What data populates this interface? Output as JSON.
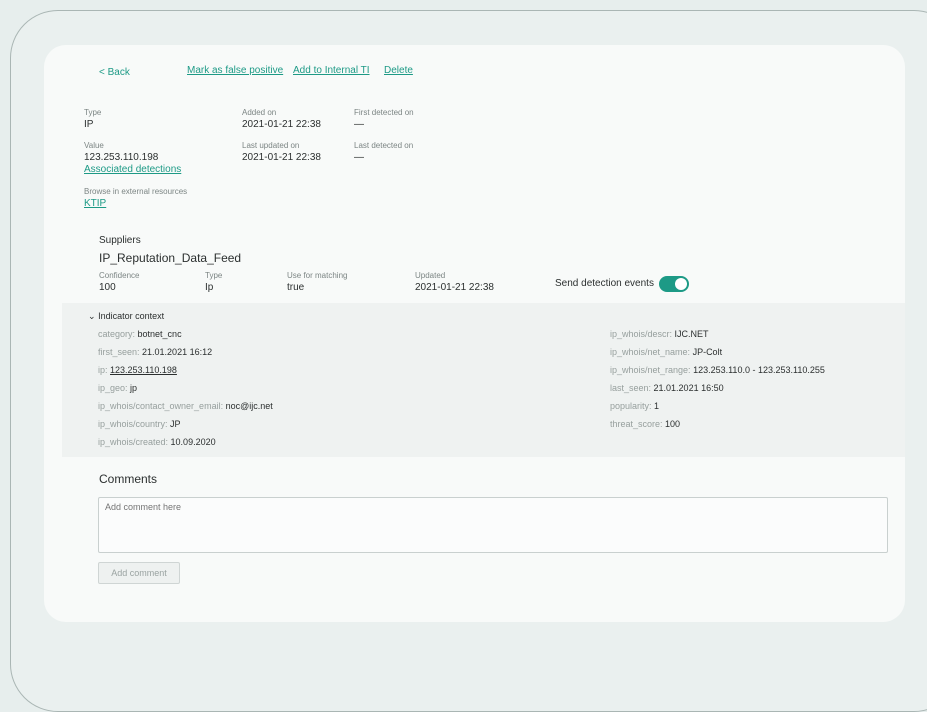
{
  "toolbar": {
    "back": "< Back",
    "mark_false_positive": "Mark as false positive",
    "add_internal_ti": "Add to Internal TI",
    "delete": "Delete"
  },
  "indicator": {
    "type_label": "Type",
    "type_value": "IP",
    "added_label": "Added on",
    "added_value": "2021-01-21 22:38",
    "first_detected_label": "First detected on",
    "first_detected_value": "—",
    "value_label": "Value",
    "value_value": "123.253.110.198",
    "associated_detections": "Associated detections",
    "last_updated_label": "Last updated on",
    "last_updated_value": "2021-01-21 22:38",
    "last_detected_label": "Last detected on",
    "last_detected_value": "—",
    "browse_label": "Browse in external resources",
    "browse_link": "KTIP"
  },
  "suppliers": {
    "title": "Suppliers",
    "name": "IP_Reputation_Data_Feed",
    "confidence_label": "Confidence",
    "confidence_value": "100",
    "type_label": "Type",
    "type_value": "Ip",
    "matching_label": "Use for matching",
    "matching_value": "true",
    "updated_label": "Updated",
    "updated_value": "2021-01-21 22:38",
    "send_events_label": "Send detection events",
    "send_events_on": true
  },
  "context": {
    "title": "Indicator context",
    "left": [
      {
        "key": "category: ",
        "value": "botnet_cnc"
      },
      {
        "key": "first_seen: ",
        "value": "21.01.2021 16:12"
      },
      {
        "key": "ip: ",
        "value": "123.253.110.198"
      },
      {
        "key": "ip_geo: ",
        "value": "jp"
      },
      {
        "key": "ip_whois/contact_owner_email: ",
        "value": "noc@ijc.net"
      },
      {
        "key": "ip_whois/country: ",
        "value": "JP"
      },
      {
        "key": "ip_whois/created: ",
        "value": "10.09.2020"
      }
    ],
    "right": [
      {
        "key": "ip_whois/descr: ",
        "value": "IJC.NET"
      },
      {
        "key": "ip_whois/net_name: ",
        "value": "JP-Colt"
      },
      {
        "key": "ip_whois/net_range: ",
        "value": "123.253.110.0 - 123.253.110.255"
      },
      {
        "key": "last_seen: ",
        "value": "21.01.2021 16:50"
      },
      {
        "key": "popularity: ",
        "value": "1"
      },
      {
        "key": "threat_score: ",
        "value": "100"
      }
    ]
  },
  "comments": {
    "title": "Comments",
    "placeholder": "Add comment here",
    "button": "Add comment"
  },
  "colors": {
    "accent": "#1d9a86",
    "background": "#e7eeed",
    "card": "#f8faf9",
    "context_bg": "#eff2f1"
  }
}
